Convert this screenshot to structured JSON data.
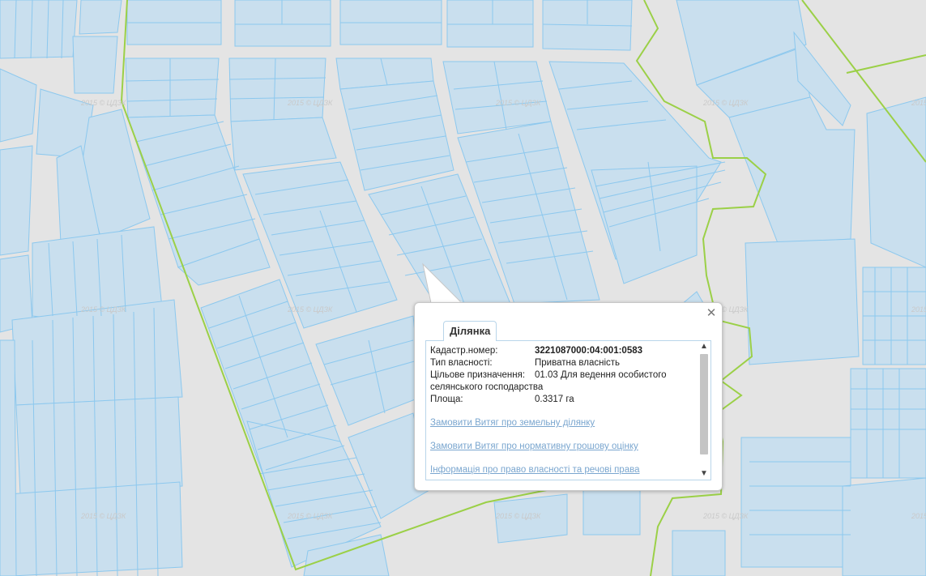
{
  "map": {
    "watermark_text": "2015 © ЦДЗК",
    "colors": {
      "background": "#e4e4e4",
      "parcel_fill": "#c9dfee",
      "parcel_stroke": "#8cc8ee",
      "boundary": "#9bd047"
    }
  },
  "popup": {
    "tab_label": "Ділянка",
    "close_glyph": "✕",
    "fields": [
      {
        "label": "Кадастр.номер:",
        "value": "3221087000:04:001:0583"
      },
      {
        "label": "Тип власності:",
        "value": "Приватна власність"
      },
      {
        "label": "Цільове призначення:",
        "value": "01.03 Для ведення особистого",
        "continuation": "селянського господарства"
      },
      {
        "label": "Площа:",
        "value": "0.3317 га"
      }
    ],
    "links": [
      "Замовити Витяг про земельну ділянку",
      "Замовити Витяг про нормативну грошову оцінку",
      "Інформація про право власності та речові права"
    ],
    "scroll_up_glyph": "▲",
    "scroll_down_glyph": "▼"
  }
}
